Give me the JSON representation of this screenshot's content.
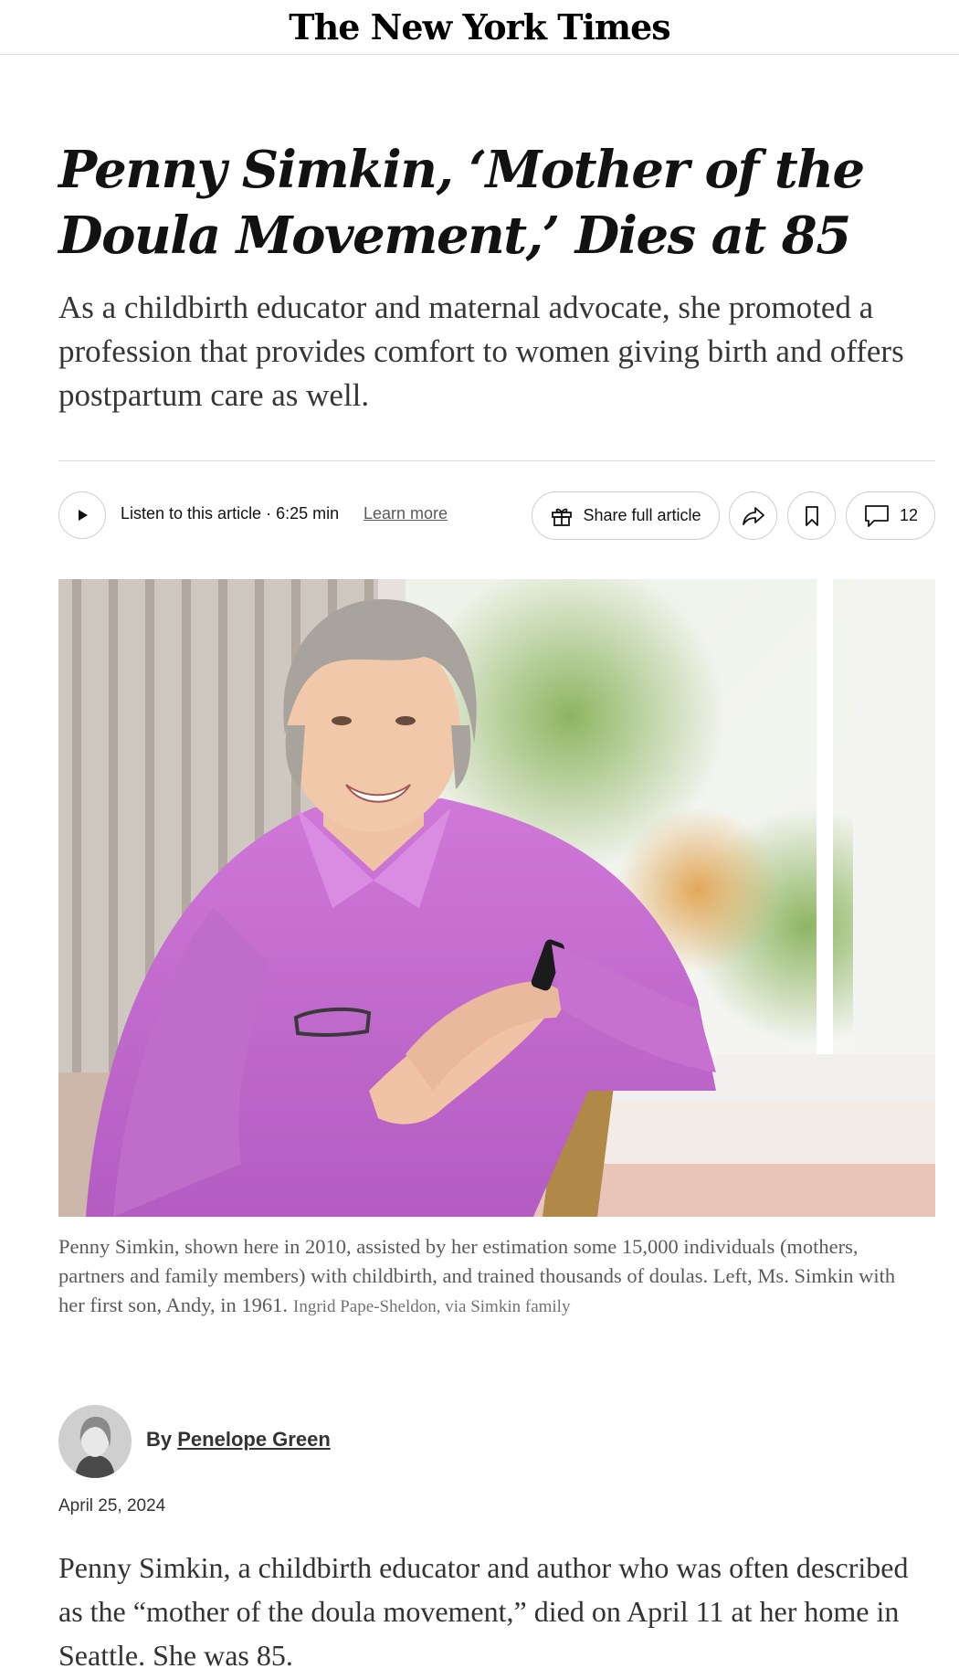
{
  "masthead": {
    "logo": "The New York Times"
  },
  "article": {
    "headline": "Penny Simkin, ‘Mother of the Doula Movement,’ Dies at 85",
    "summary": "As a childbirth educator and maternal advocate, she promoted a profession that provides comfort to women giving birth and offers postpartum care as well.",
    "caption": "Penny Simkin, shown here in 2010, assisted by her estimation some 15,000 individuals (mothers, partners and family members) with childbirth, and trained thousands of doulas. Left, Ms. Simkin with her first son, Andy, in 1961.",
    "credit": "Ingrid Pape-Sheldon, via Simkin family",
    "byline_prefix": "By",
    "author": "Penelope Green",
    "date": "April 25, 2024",
    "body": "Penny Simkin, a childbirth educator and author who was often described as the “mother of the doula movement,” died on April 11 at her home in Seattle. She was 85."
  },
  "toolbar": {
    "listen_label": "Listen to this article · 6:25 min",
    "learn_more": "Learn more",
    "share_full": "Share full article",
    "comment_count": "12",
    "icons": [
      "play-icon",
      "gift-icon",
      "share-arrow-icon",
      "bookmark-icon",
      "comment-icon"
    ]
  },
  "colors": {
    "text": "#121212",
    "muted": "#5a5a5a",
    "border": "#dcdcdc",
    "shirt": "#c96ad3"
  }
}
